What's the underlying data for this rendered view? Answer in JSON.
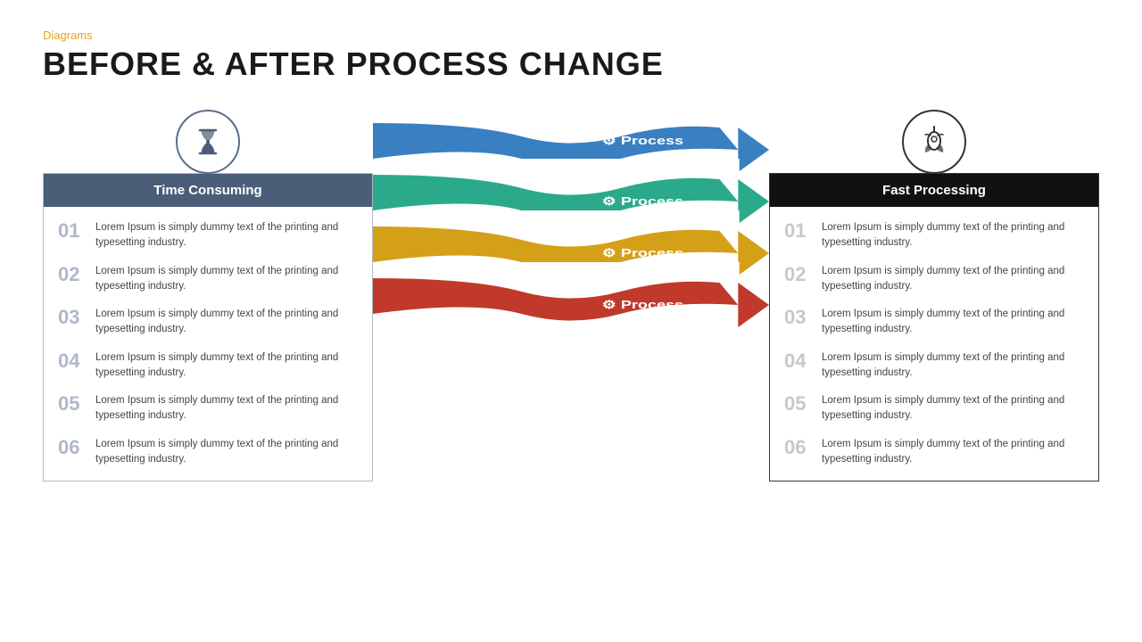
{
  "header": {
    "tag": "Diagrams",
    "title": "BEFORE & AFTER PROCESS CHANGE"
  },
  "left_panel": {
    "icon_label": "hourglass-icon",
    "header": "Time Consuming",
    "items": [
      {
        "num": "01",
        "text": "Lorem Ipsum is simply dummy text of the printing and typesetting industry."
      },
      {
        "num": "02",
        "text": "Lorem Ipsum is simply dummy text of the printing and typesetting industry."
      },
      {
        "num": "03",
        "text": "Lorem Ipsum is simply dummy text of the printing and typesetting industry."
      },
      {
        "num": "04",
        "text": "Lorem Ipsum is simply dummy text of the printing and typesetting industry."
      },
      {
        "num": "05",
        "text": "Lorem Ipsum is simply dummy text of the printing and typesetting industry."
      },
      {
        "num": "06",
        "text": "Lorem Ipsum is simply dummy text of the printing and typesetting industry."
      }
    ]
  },
  "arrows": [
    {
      "label": "Process",
      "color": "#3a7fc1"
    },
    {
      "label": "Process",
      "color": "#2aaa8a"
    },
    {
      "label": "Process",
      "color": "#d4a017"
    },
    {
      "label": "Process",
      "color": "#c0392b"
    }
  ],
  "right_panel": {
    "icon_label": "rocket-icon",
    "header": "Fast Processing",
    "items": [
      {
        "num": "01",
        "text": "Lorem Ipsum is simply dummy text of the printing and typesetting industry."
      },
      {
        "num": "02",
        "text": "Lorem Ipsum is simply dummy text of the printing and typesetting industry."
      },
      {
        "num": "03",
        "text": "Lorem Ipsum is simply dummy text of the printing and typesetting industry."
      },
      {
        "num": "04",
        "text": "Lorem Ipsum is simply dummy text of the printing and typesetting industry."
      },
      {
        "num": "05",
        "text": "Lorem Ipsum is simply dummy text of the printing and typesetting industry."
      },
      {
        "num": "06",
        "text": "Lorem Ipsum is simply dummy text of the printing and typesetting industry."
      }
    ]
  },
  "colors": {
    "accent": "#e8a020",
    "left_header_bg": "#4a5e78",
    "right_header_bg": "#111111",
    "arrow_blue": "#3a7fc1",
    "arrow_teal": "#2aaa8a",
    "arrow_yellow": "#d4a017",
    "arrow_red": "#c0392b"
  }
}
